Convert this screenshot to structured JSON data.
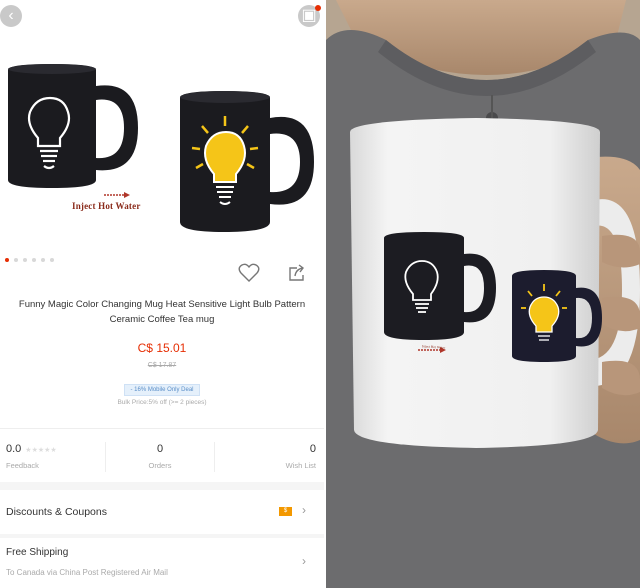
{
  "product": {
    "title": "Funny Magic Color Changing Mug Heat Sensitive Light Bulb Pattern Ceramic Coffee Tea mug",
    "price": "C$ 15.01",
    "old_price": "C$ 17.87",
    "deal_badge": "- 16% Mobile Only Deal",
    "bulk_price": "Bulk Price:5% off (>= 2 pieces)",
    "image_caption": "Inject Hot Water",
    "gallery_count": 6,
    "gallery_active": 0
  },
  "stats": {
    "rating": "0.0",
    "feedback_label": "Feedback",
    "orders": "0",
    "orders_label": "Orders",
    "wish": "0",
    "wish_label": "Wish List"
  },
  "rows": {
    "coupons_label": "Discounts & Coupons",
    "coupon_badge": "$",
    "shipping_title": "Free Shipping",
    "shipping_sub": "To Canada via China Post Registered Air Mail"
  },
  "photo_caption": "Inject Hot Water",
  "colors": {
    "accent": "#e62e04",
    "mug_black": "#1b1b1f",
    "bulb_yellow": "#f5c518",
    "shirt_gray": "#6e6e70"
  }
}
